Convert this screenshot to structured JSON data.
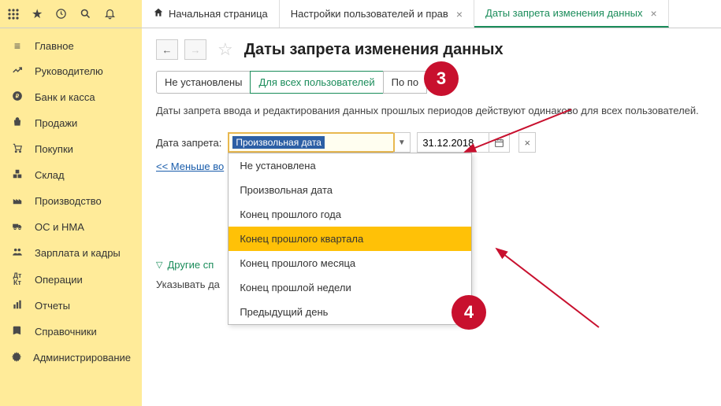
{
  "topbar": {
    "tabs": [
      {
        "label": "Начальная страница",
        "has_close": false
      },
      {
        "label": "Настройки пользователей и прав",
        "has_close": true
      },
      {
        "label": "Даты запрета изменения данных",
        "has_close": true,
        "active": true
      }
    ]
  },
  "sidebar": {
    "items": [
      {
        "label": "Главное"
      },
      {
        "label": "Руководителю"
      },
      {
        "label": "Банк и касса"
      },
      {
        "label": "Продажи"
      },
      {
        "label": "Покупки"
      },
      {
        "label": "Склад"
      },
      {
        "label": "Производство"
      },
      {
        "label": "ОС и НМА"
      },
      {
        "label": "Зарплата и кадры"
      },
      {
        "label": "Операции"
      },
      {
        "label": "Отчеты"
      },
      {
        "label": "Справочники"
      },
      {
        "label": "Администрирование"
      }
    ]
  },
  "content": {
    "title": "Даты запрета изменения данных",
    "filters": [
      {
        "label": "Не установлены"
      },
      {
        "label": "Для всех пользователей",
        "active": true
      },
      {
        "label": "По по"
      }
    ],
    "description": "Даты запрета ввода и редактирования данных прошлых периодов действуют одинаково для всех пользователей.",
    "date_label": "Дата запрета:",
    "combo_value": "Произвольная дата",
    "date_value": "31.12.2018",
    "less_link": "<< Меньше во",
    "dropdown": [
      "Не установлена",
      "Произвольная дата",
      "Конец прошлого года",
      "Конец прошлого квартала",
      "Конец прошлого месяца",
      "Конец прошлой недели",
      "Предыдущий день"
    ],
    "dropdown_highlighted_index": 3,
    "other_ways": "Другие сп",
    "sub_text": "Указывать да"
  },
  "annotations": [
    {
      "num": "3"
    },
    {
      "num": "4"
    }
  ]
}
